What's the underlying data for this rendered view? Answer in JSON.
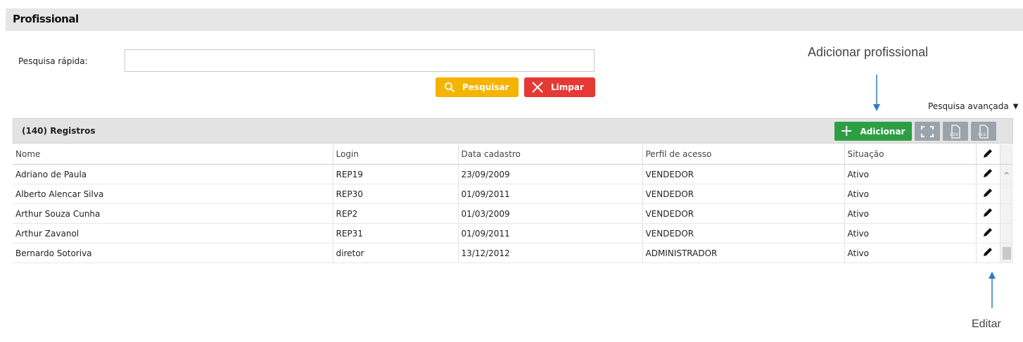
{
  "page": {
    "title": "Profissional"
  },
  "search": {
    "label": "Pesquisa rápida:",
    "value": "",
    "placeholder": "",
    "search_button": "Pesquisar",
    "clear_button": "Limpar",
    "advanced_label": "Pesquisa avançada"
  },
  "annotations": {
    "add": "Adicionar profissional",
    "edit": "Editar"
  },
  "grid": {
    "records_label": "(140) Registros",
    "add_button": "Adicionar",
    "csv_icon_text": "CSV",
    "xls_icon_text": "XLS",
    "columns": [
      "Nome",
      "Login",
      "Data cadastro",
      "Perfil de acesso",
      "Situação"
    ],
    "rows": [
      [
        "Adriano de Paula",
        "REP19",
        "23/09/2009",
        "VENDEDOR",
        "Ativo"
      ],
      [
        "Alberto Alencar Silva",
        "REP30",
        "01/09/2011",
        "VENDEDOR",
        "Ativo"
      ],
      [
        "Arthur Souza Cunha",
        "REP2",
        "01/03/2009",
        "VENDEDOR",
        "Ativo"
      ],
      [
        "Arthur Zavanol",
        "REP31",
        "01/09/2011",
        "VENDEDOR",
        "Ativo"
      ],
      [
        "Bernardo Sotoriva",
        "diretor",
        "13/12/2012",
        "ADMINISTRADOR",
        "Ativo"
      ]
    ]
  },
  "colors": {
    "search_button": "#f4b400",
    "clear_button": "#e53935",
    "add_button": "#2e9e44",
    "tool_button": "#9ba3ac",
    "annotation_arrow": "#2d7bbf"
  },
  "icons": {
    "search": "search-icon",
    "clear": "close-icon",
    "add": "plus-icon",
    "expand": "fullscreen-icon",
    "csv": "csv-file-icon",
    "xls": "xls-file-icon",
    "edit": "pencil-icon",
    "advanced": "caret-down-icon"
  }
}
